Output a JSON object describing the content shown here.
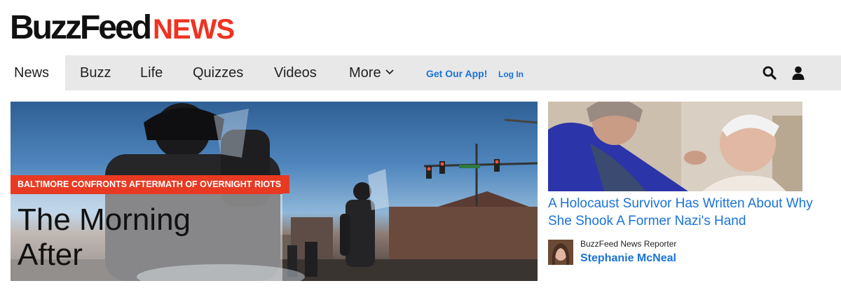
{
  "logo": {
    "part1": "BuzzFeed",
    "part2": "NEWS"
  },
  "nav": {
    "items": [
      "News",
      "Buzz",
      "Life",
      "Quizzes",
      "Videos",
      "More"
    ],
    "active": "News",
    "app_link": "Get Our App!",
    "login": "Log In",
    "icons": {
      "search": "search-icon",
      "user": "user-icon",
      "more": "chevron-down-icon"
    }
  },
  "hero": {
    "tag": "BALTIMORE CONFRONTS AFTERMATH OF OVERNIGHT RIOTS",
    "title_line1": "The Morning",
    "title_line2": "After"
  },
  "side_story": {
    "title": "A Holocaust Survivor Has Written About Why She Shook A Former Nazi's Hand",
    "author_role": "BuzzFeed News Reporter",
    "author_name": "Stephanie McNeal"
  },
  "colors": {
    "brand_red": "#ee3322",
    "link_blue": "#1a73d9",
    "nav_bg": "#e8e8e8",
    "tag_red": "#e83a22"
  }
}
